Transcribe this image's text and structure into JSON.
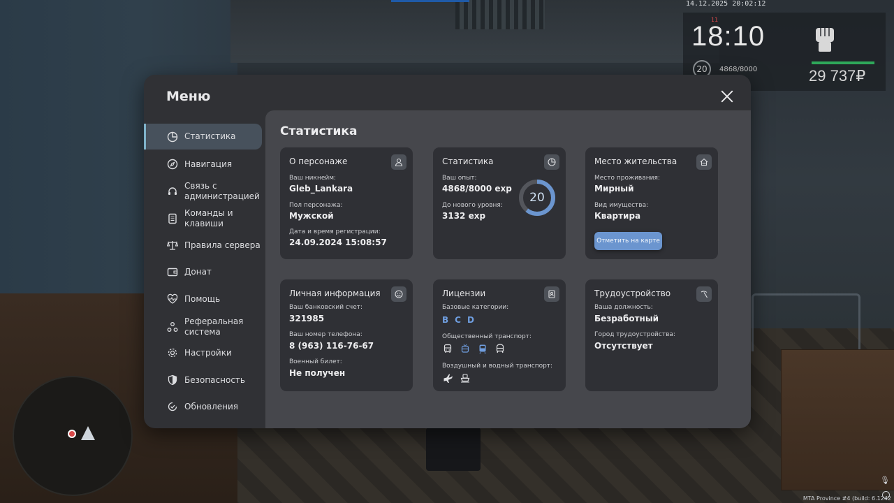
{
  "hud": {
    "datetime": "14.12.2025 20:02:12",
    "tiny_mark": "11",
    "time": "18:10",
    "level": "20",
    "exp": "4868/8000",
    "money": "29 737₽",
    "bar_color": "#2ea85a"
  },
  "footer": {
    "build": "MTA Province #4 (build: 6.1242",
    "mic_icon": "microphone-icon"
  },
  "menu": {
    "title": "Меню",
    "nav": [
      {
        "label": "Статистика",
        "icon": "pie-chart-icon",
        "active": true
      },
      {
        "label": "Навигация",
        "icon": "compass-icon"
      },
      {
        "label": "Связь с\nадминистрацией",
        "icon": "headset-icon"
      },
      {
        "label": "Команды и\nклавиши",
        "icon": "document-icon"
      },
      {
        "label": "Правила сервера",
        "icon": "scales-icon"
      },
      {
        "label": "Донат",
        "icon": "wallet-icon"
      },
      {
        "label": "Помощь",
        "icon": "heart-pulse-icon"
      },
      {
        "label": "Реферальная\nсистема",
        "icon": "network-icon"
      },
      {
        "label": "Настройки",
        "icon": "gear-icon"
      },
      {
        "label": "Безопасность",
        "icon": "shield-icon"
      },
      {
        "label": "Обновления",
        "icon": "refresh-check-icon"
      }
    ]
  },
  "content": {
    "title": "Статистика",
    "character": {
      "title": "О персонаже",
      "icon": "user-icon",
      "nickname_label": "Ваш никнейм:",
      "nickname": "Gleb_Lankara",
      "gender_label": "Пол персонажа:",
      "gender": "Мужской",
      "reg_label": "Дата и время регистрации:",
      "reg": "24.09.2024 15:08:57"
    },
    "stats": {
      "title": "Статистика",
      "icon": "pie-chart-icon",
      "exp_label": "Ваш опыт:",
      "exp": "4868/8000 exp",
      "next_label": "До нового уровня:",
      "next": "3132 exp",
      "level": "20",
      "progress": 0.6085,
      "accent": "#6b95cf"
    },
    "residence": {
      "title": "Место жительства",
      "icon": "house-icon",
      "place_label": "Место проживания:",
      "place": "Мирный",
      "property_label": "Вид имущества:",
      "property": "Квартира",
      "map_button": "Отметить на карте"
    },
    "personal": {
      "title": "Личная информация",
      "icon": "smiley-icon",
      "bank_label": "Ваш банковский счет:",
      "bank": "321985",
      "phone_label": "Ваш номер телефона:",
      "phone": "8 (963) 116-76-67",
      "military_label": "Военный билет:",
      "military": "Не получен"
    },
    "licenses": {
      "title": "Лицензии",
      "icon": "id-card-icon",
      "base_label": "Базовые категории:",
      "categories": [
        "B",
        "C",
        "D"
      ],
      "public_label": "Общественный транспорт:",
      "public_icons": [
        "bus-icon",
        "trolleybus-icon",
        "tram-icon",
        "metro-icon"
      ],
      "air_label": "Воздушный и водный транспорт:",
      "air_icons": [
        "airplane-icon",
        "boat-icon"
      ]
    },
    "job": {
      "title": "Трудоустройство",
      "icon": "pickaxe-icon",
      "position_label": "Ваша должность:",
      "position": "Безработный",
      "city_label": "Город трудоустройства:",
      "city": "Отсутствует"
    }
  }
}
